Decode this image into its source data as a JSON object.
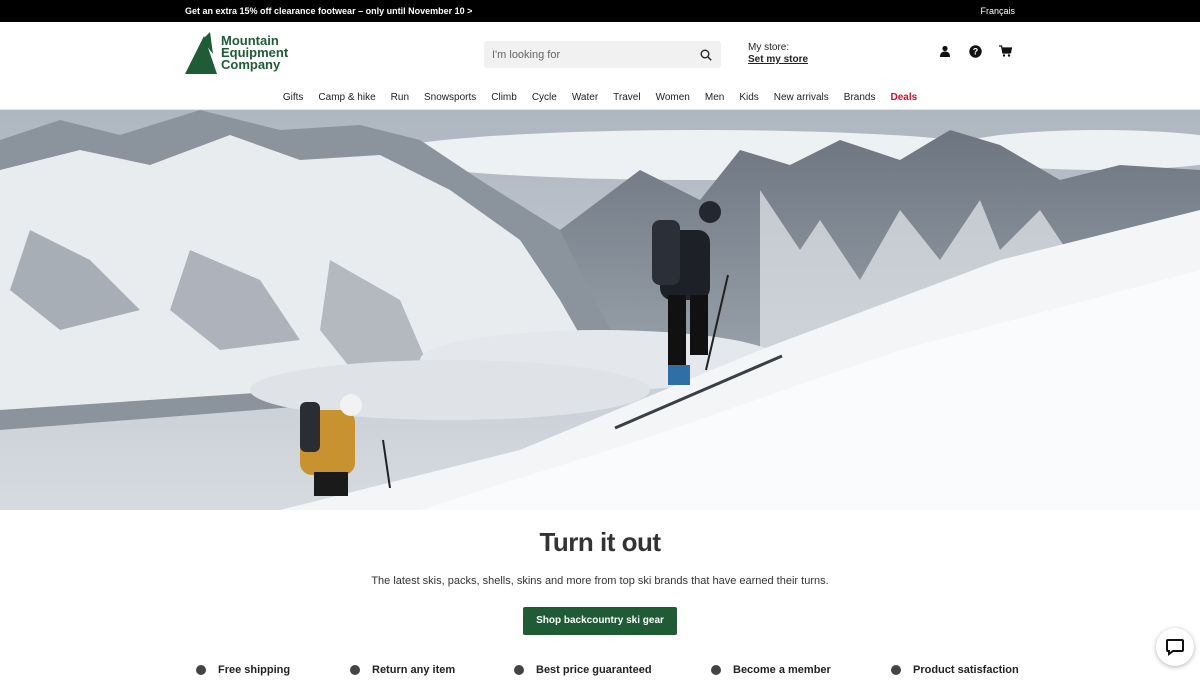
{
  "promo": {
    "text": "Get an extra 15% off clearance footwear – only until November 10 >",
    "lang_link": "Français"
  },
  "brand": {
    "line1": "Mountain",
    "line2": "Equipment",
    "line3": "Company",
    "color": "#1f5b34"
  },
  "search": {
    "placeholder": "I'm looking for",
    "icon": "search-icon"
  },
  "store": {
    "label": "My store:",
    "link": "Set my store"
  },
  "utility_icons": [
    "account-icon",
    "help-icon",
    "cart-icon"
  ],
  "nav": {
    "items": [
      "Gifts",
      "Camp & hike",
      "Run",
      "Snowsports",
      "Climb",
      "Cycle",
      "Water",
      "Travel",
      "Women",
      "Men",
      "Kids",
      "New arrivals",
      "Brands"
    ],
    "deals": "Deals",
    "deals_color": "#c8102e"
  },
  "hero": {
    "title": "Turn it out",
    "subtitle": "The latest skis, packs, shells, skins and more from top ski brands that have earned their turns.",
    "cta": "Shop backcountry ski gear"
  },
  "features": [
    "Free shipping",
    "Return any item",
    "Best price guaranteed",
    "Become a member",
    "Product satisfaction"
  ],
  "chat": {
    "icon": "chat-icon"
  }
}
